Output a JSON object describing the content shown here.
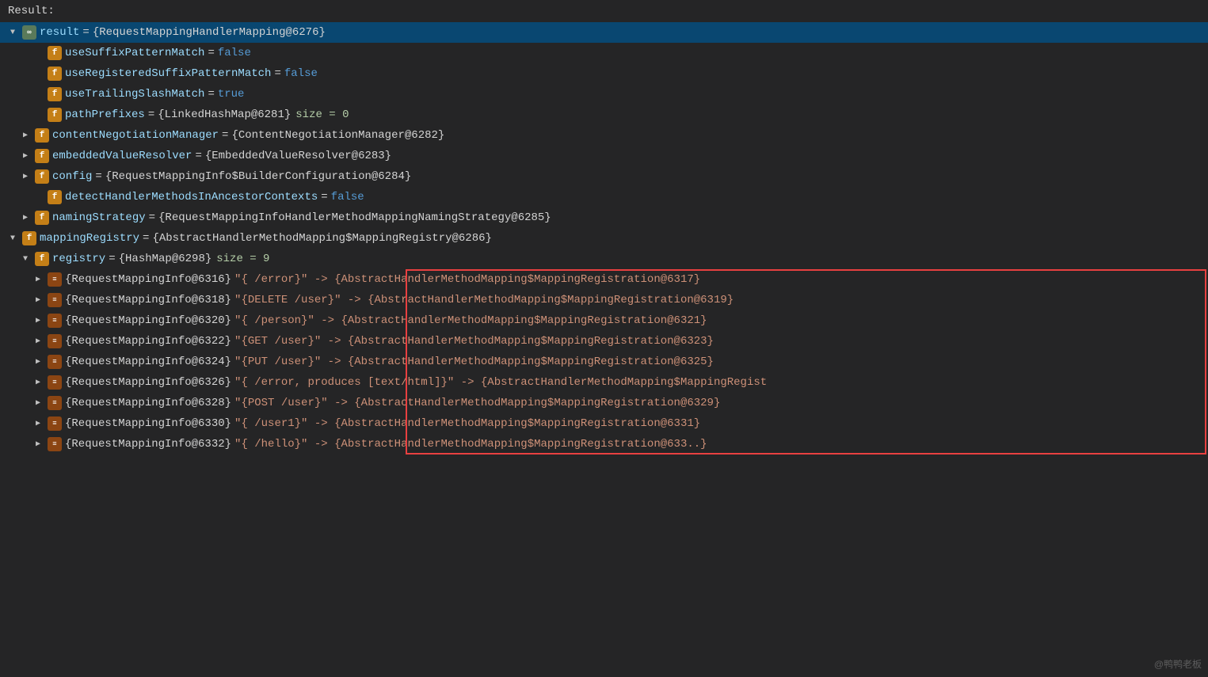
{
  "header": {
    "result_label": "Result:"
  },
  "root": {
    "label": "result = {RequestMappingHandlerMapping@6276}",
    "expanded": true,
    "selected": true
  },
  "fields": [
    {
      "id": "useSuffixPatternMatch",
      "indent": 2,
      "badge": "f",
      "name": "useSuffixPatternMatch",
      "value": "false",
      "valueType": "bool",
      "expandable": false
    },
    {
      "id": "useRegisteredSuffixPatternMatch",
      "indent": 2,
      "badge": "f",
      "name": "useRegisteredSuffixPatternMatch",
      "value": "false",
      "valueType": "bool",
      "expandable": false
    },
    {
      "id": "useTrailingSlashMatch",
      "indent": 2,
      "badge": "f",
      "name": "useTrailingSlashMatch",
      "value": "true",
      "valueType": "bool",
      "expandable": false
    },
    {
      "id": "pathPrefixes",
      "indent": 2,
      "badge": "f",
      "name": "pathPrefixes",
      "value": "{LinkedHashMap@6281}",
      "valueType": "ref",
      "extra": " size = 0",
      "expandable": false
    },
    {
      "id": "contentNegotiationManager",
      "indent": 2,
      "badge": "f",
      "name": "contentNegotiationManager",
      "value": "{ContentNegotiationManager@6282}",
      "valueType": "ref",
      "expandable": true,
      "expanded": false
    },
    {
      "id": "embeddedValueResolver",
      "indent": 2,
      "badge": "f",
      "name": "embeddedValueResolver",
      "value": "{EmbeddedValueResolver@6283}",
      "valueType": "ref",
      "expandable": true,
      "expanded": false
    },
    {
      "id": "config",
      "indent": 2,
      "badge": "f",
      "name": "config",
      "value": "{RequestMappingInfo$BuilderConfiguration@6284}",
      "valueType": "ref",
      "expandable": true,
      "expanded": false
    },
    {
      "id": "detectHandlerMethodsInAncestorContexts",
      "indent": 2,
      "badge": "f",
      "name": "detectHandlerMethodsInAncestorContexts",
      "value": "false",
      "valueType": "bool",
      "expandable": false,
      "highlighted": true
    },
    {
      "id": "namingStrategy",
      "indent": 2,
      "badge": "f",
      "name": "namingStrategy",
      "value": "{RequestMappingInfoHandlerMethodMappingNamingStrategy@6285}",
      "valueType": "ref",
      "expandable": true,
      "expanded": false
    },
    {
      "id": "mappingRegistry",
      "indent": 1,
      "badge": "f",
      "name": "mappingRegistry",
      "value": "{AbstractHandlerMethodMapping$MappingRegistry@6286}",
      "valueType": "ref",
      "expandable": true,
      "expanded": true
    },
    {
      "id": "registry",
      "indent": 2,
      "badge": "f",
      "name": "registry",
      "value": "{HashMap@6298}",
      "valueType": "ref",
      "extra": " size = 9",
      "expandable": true,
      "expanded": true
    }
  ],
  "registry_entries": [
    {
      "id": "entry_6316",
      "indent": 3,
      "keyRef": "{RequestMappingInfo@6316}",
      "valueStr": "\"{  /error}\" -> {AbstractHandlerMethodMapping$MappingRegistration@6317}",
      "bordered": true
    },
    {
      "id": "entry_6318",
      "indent": 3,
      "keyRef": "{RequestMappingInfo@6318}",
      "valueStr": "\"{DELETE /user}\" -> {AbstractHandlerMethodMapping$MappingRegistration@6319}",
      "bordered": true
    },
    {
      "id": "entry_6320",
      "indent": 3,
      "keyRef": "{RequestMappingInfo@6320}",
      "valueStr": "\"{  /person}\" -> {AbstractHandlerMethodMapping$MappingRegistration@6321}",
      "bordered": true
    },
    {
      "id": "entry_6322",
      "indent": 3,
      "keyRef": "{RequestMappingInfo@6322}",
      "valueStr": "\"{GET /user}\" -> {AbstractHandlerMethodMapping$MappingRegistration@6323}",
      "bordered": true
    },
    {
      "id": "entry_6324",
      "indent": 3,
      "keyRef": "{RequestMappingInfo@6324}",
      "valueStr": "\"{PUT /user}\" -> {AbstractHandlerMethodMapping$MappingRegistration@6325}",
      "bordered": true
    },
    {
      "id": "entry_6326",
      "indent": 3,
      "keyRef": "{RequestMappingInfo@6326}",
      "valueStr": "\"{  /error, produces [text/html]}\" -> {AbstractHandlerMethodMapping$MappingRegist",
      "bordered": true
    },
    {
      "id": "entry_6328",
      "indent": 3,
      "keyRef": "{RequestMappingInfo@6328}",
      "valueStr": "\"{POST /user}\" -> {AbstractHandlerMethodMapping$MappingRegistration@6329}",
      "bordered": true
    },
    {
      "id": "entry_6330",
      "indent": 3,
      "keyRef": "{RequestMappingInfo@6330}",
      "valueStr": "\"{  /user1}\" -> {AbstractHandlerMethodMapping$MappingRegistration@6331}",
      "bordered": true
    },
    {
      "id": "entry_6332",
      "indent": 3,
      "keyRef": "{RequestMappingInfo@6332}",
      "valueStr": "\"{  /hello}\" -> {AbstractHandlerMethodMapping$MappingRegistration@633..}",
      "bordered": true
    }
  ],
  "watermark": "@鸭鸭老板",
  "colors": {
    "selected_bg": "#094771",
    "border_red": "#e84040",
    "badge_f": "#c47f17",
    "bool_color": "#569cd6",
    "ref_color": "#d4d4d4",
    "name_color": "#9cdcfe"
  }
}
